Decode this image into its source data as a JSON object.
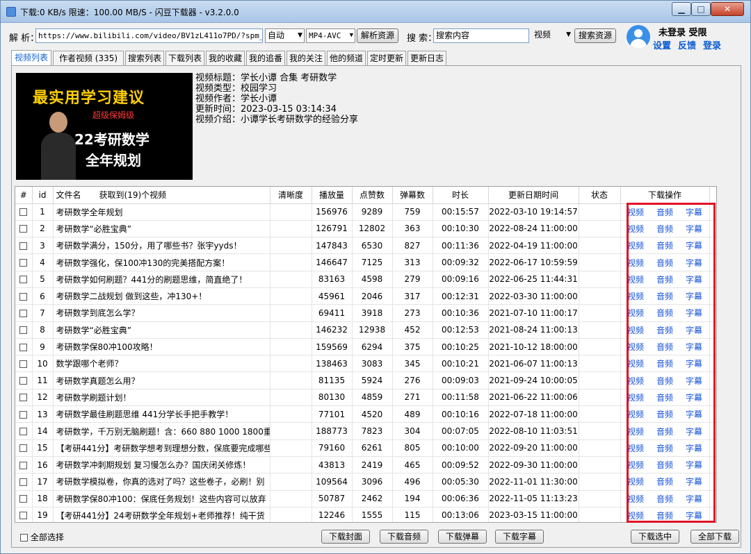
{
  "window": {
    "title": "下载:0 KB/s 限速：100.00 MB/S  - 闪豆下载器 - v3.2.0.0",
    "btn_min": "▁",
    "btn_max": "□",
    "btn_close": "✕"
  },
  "address": {
    "label": "解 析：",
    "url": "https://www.bilibili.com/video/BV1zL411o7PD/?spm_id_f",
    "mode": "自动",
    "format": "MP4-AVC",
    "parse_button": "解析资源",
    "search_label": "搜 索：",
    "search_placeholder": "搜索内容",
    "search_type": "视频",
    "search_button": "搜索资源"
  },
  "user": {
    "status": "未登录 受限",
    "settings": "设置",
    "feedback": "反馈",
    "login": "登录"
  },
  "tabs": [
    "视频列表",
    "作者视频 (335)",
    "搜索列表",
    "下载列表",
    "我的收藏",
    "我的追番",
    "我的关注",
    "他的频道",
    "定时更新",
    "更新日志"
  ],
  "video": {
    "thumb_line1": "最实用学习建议",
    "thumb_line2": "超级保姆级",
    "thumb_line3": "22考研数学",
    "thumb_line4": "全年规划",
    "title": "视频标题：学长小谭 合集 考研数学",
    "type": "视频类型：校园学习",
    "author": "视频作者：学长小谭",
    "updated": "更新时间：2023-03-15 03:14:34",
    "intro": "视频介绍：小谭学长考研数学的经验分享"
  },
  "table": {
    "headers": {
      "num": "#",
      "id": "id",
      "name": "文件名",
      "found": "获取到(19)个视频",
      "quality": "清晰度",
      "plays": "播放量",
      "likes": "点赞数",
      "danmaku": "弹幕数",
      "duration": "时长",
      "date": "更新日期时间",
      "status": "状态",
      "ops": "下载操作"
    },
    "action_video": "视频",
    "action_audio": "音频",
    "action_sub": "字幕",
    "rows": [
      {
        "id": "1",
        "name": "考研数学全年规划",
        "plays": "156976",
        "likes": "9289",
        "danmaku": "759",
        "duration": "00:15:57",
        "date": "2022-03-10 19:14:57"
      },
      {
        "id": "2",
        "name": "考研数学“必胜宝典”",
        "plays": "126791",
        "likes": "12802",
        "danmaku": "363",
        "duration": "00:10:30",
        "date": "2022-08-24 11:00:00"
      },
      {
        "id": "3",
        "name": "考研数学满分，150分，用了哪些书？张宇yyds！",
        "plays": "147843",
        "likes": "6530",
        "danmaku": "827",
        "duration": "00:11:36",
        "date": "2022-04-19 11:00:00"
      },
      {
        "id": "4",
        "name": "考研数学强化，保100冲130的完美搭配方案！",
        "plays": "146647",
        "likes": "7125",
        "danmaku": "313",
        "duration": "00:09:32",
        "date": "2022-06-17 10:59:59"
      },
      {
        "id": "5",
        "name": "考研数学如何刷题？441分的刷题思维，简直绝了！",
        "plays": "83163",
        "likes": "4598",
        "danmaku": "279",
        "duration": "00:09:16",
        "date": "2022-06-25 11:44:31"
      },
      {
        "id": "6",
        "name": "考研数学二战规划  做到这些，冲130+！",
        "plays": "45961",
        "likes": "2046",
        "danmaku": "317",
        "duration": "00:12:31",
        "date": "2022-03-30 11:00:00"
      },
      {
        "id": "7",
        "name": "考研数学到底怎么学？",
        "plays": "69411",
        "likes": "3918",
        "danmaku": "273",
        "duration": "00:10:36",
        "date": "2021-07-10 11:00:17"
      },
      {
        "id": "8",
        "name": "考研数学“必胜宝典”",
        "plays": "146232",
        "likes": "12938",
        "danmaku": "452",
        "duration": "00:12:53",
        "date": "2021-08-24 11:00:13"
      },
      {
        "id": "9",
        "name": "考研数学保80冲100攻略！",
        "plays": "159569",
        "likes": "6294",
        "danmaku": "375",
        "duration": "00:10:25",
        "date": "2021-10-12 18:00:00"
      },
      {
        "id": "10",
        "name": "数学跟哪个老师？",
        "plays": "138463",
        "likes": "3083",
        "danmaku": "345",
        "duration": "00:10:21",
        "date": "2021-06-07 11:00:13"
      },
      {
        "id": "11",
        "name": "考研数学真题怎么用？",
        "plays": "81135",
        "likes": "5924",
        "danmaku": "276",
        "duration": "00:09:03",
        "date": "2021-09-24 10:00:05"
      },
      {
        "id": "12",
        "name": "考研数学刷题计划！",
        "plays": "80130",
        "likes": "4859",
        "danmaku": "271",
        "duration": "00:11:58",
        "date": "2021-06-22 11:00:06"
      },
      {
        "id": "13",
        "name": "考研数学最佳刷题思维  441分学长手把手教学！",
        "plays": "77101",
        "likes": "4520",
        "danmaku": "489",
        "duration": "00:10:16",
        "date": "2022-07-18 11:00:00"
      },
      {
        "id": "14",
        "name": "考研数学，千万别无脑刷题！含：660 880 1000 1800重",
        "plays": "188773",
        "likes": "7823",
        "danmaku": "304",
        "duration": "00:07:05",
        "date": "2022-08-10 11:03:51"
      },
      {
        "id": "15",
        "name": "【考研441分】考研数学想考到理想分数，保底要完成哪些",
        "plays": "79160",
        "likes": "6261",
        "danmaku": "805",
        "duration": "00:10:00",
        "date": "2022-09-20 11:00:00"
      },
      {
        "id": "16",
        "name": "考研数学冲刺期规划  复习慢怎么办？国庆闭关修炼！",
        "plays": "43813",
        "likes": "2419",
        "danmaku": "465",
        "duration": "00:09:52",
        "date": "2022-09-30 11:00:00"
      },
      {
        "id": "17",
        "name": "考研数学模拟卷，你真的选对了吗？这些卷子，必刷！别",
        "plays": "109564",
        "likes": "3096",
        "danmaku": "496",
        "duration": "00:05:30",
        "date": "2022-11-01 11:30:00"
      },
      {
        "id": "18",
        "name": "考研数学保80冲100：保底任务规划！这些内容可以放弃",
        "plays": "50787",
        "likes": "2462",
        "danmaku": "194",
        "duration": "00:06:36",
        "date": "2022-11-05 11:13:23"
      },
      {
        "id": "19",
        "name": "【考研441分】24考研数学全年规划+老师推荐！纯干货",
        "plays": "12246",
        "likes": "1555",
        "danmaku": "115",
        "duration": "00:13:06",
        "date": "2023-03-15 11:00:00"
      }
    ]
  },
  "bottom": {
    "select_all": "全部选择",
    "dl_cover": "下载封面",
    "dl_audio": "下载音频",
    "dl_danmaku": "下载弹幕",
    "dl_sub": "下载字幕",
    "dl_selected": "下载选中",
    "dl_all": "全部下载"
  },
  "colors": {
    "accent": "#1452d8",
    "highlight_box": "#e01025",
    "title_bar": "#b6cfec"
  }
}
